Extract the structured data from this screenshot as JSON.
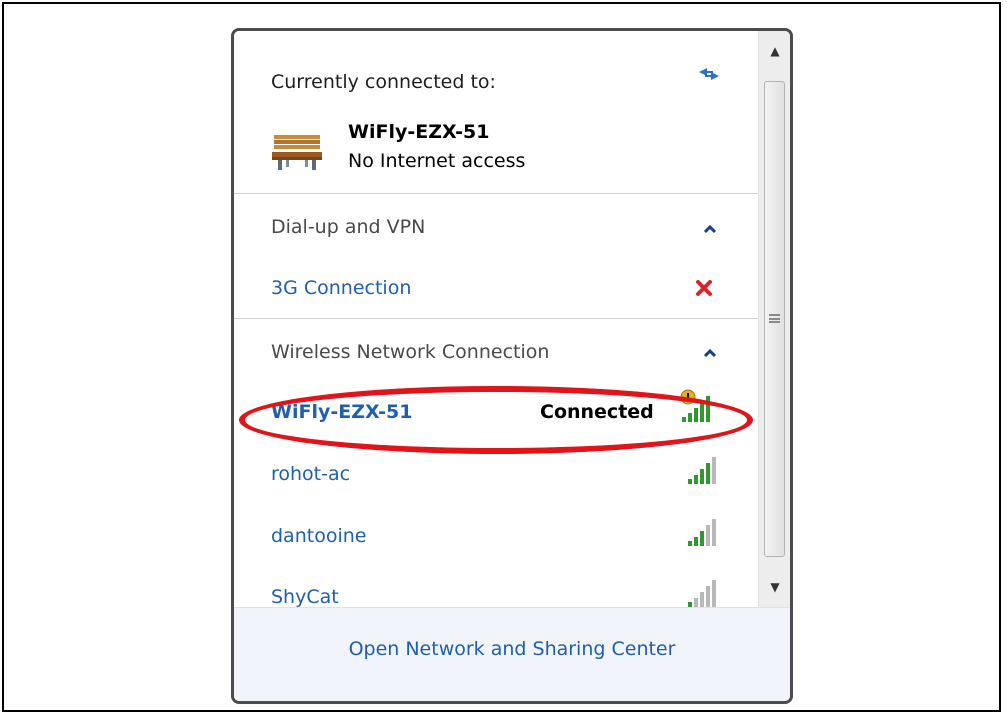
{
  "header": {
    "title": "Currently connected to:",
    "refresh_icon": "network-refresh-icon"
  },
  "current_connection": {
    "name": "WiFly-EZX-51",
    "status": "No Internet access",
    "icon": "bench-network-icon"
  },
  "groups": [
    {
      "label": "Dial-up and VPN",
      "items": [
        {
          "name": "3G Connection",
          "status_icon": "disconnected-x-icon"
        }
      ]
    },
    {
      "label": "Wireless Network Connection",
      "items": [
        {
          "name": "WiFly-EZX-51",
          "status": "Connected",
          "signal_bars": 5
        },
        {
          "name": "rohot-ac",
          "signal_bars": 4
        },
        {
          "name": "dantooine",
          "signal_bars": 3
        },
        {
          "name": "ShyCat",
          "signal_bars": 2
        }
      ]
    }
  ],
  "footer": {
    "link": "Open Network and Sharing Center"
  },
  "colors": {
    "link_blue": "#1f5fad",
    "highlight_red": "#e0141a",
    "signal_green": "#2e9a2e",
    "signal_gray": "#b8b8b8"
  }
}
